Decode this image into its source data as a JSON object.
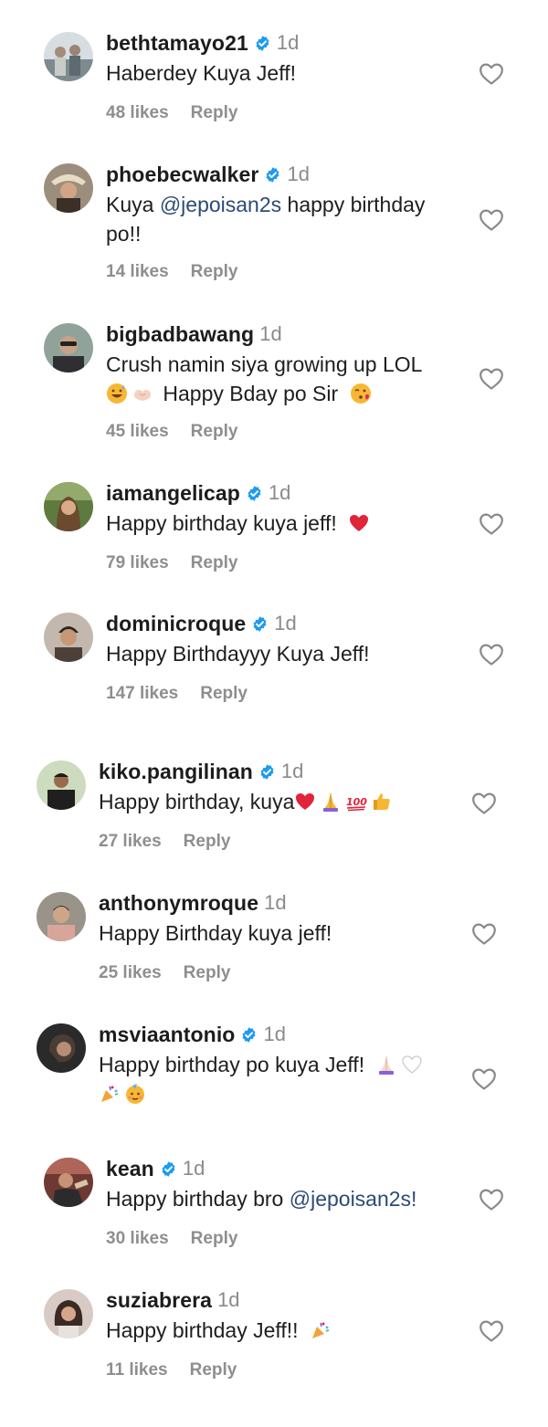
{
  "comments": [
    {
      "username": "bethtamayo21",
      "verified": true,
      "time": "1d",
      "text": "Haberdey Kuya Jeff!",
      "likes": "48 likes",
      "reply": "Reply",
      "avatar_color": "#7d8a8f"
    },
    {
      "username": "phoebecwalker",
      "verified": true,
      "time": "1d",
      "text_before": "Kuya ",
      "mention": "@jepoisan2s",
      "text_after": " happy birthday",
      "text_line2": "po!!",
      "likes": "14 likes",
      "reply": "Reply",
      "avatar_color": "#4a4038"
    },
    {
      "username": "bigbadbawang",
      "verified": false,
      "time": "1d",
      "text_line1": "Crush namin siya growing up LOL",
      "text_line2": "Happy Bday po Sir",
      "emojis_line2_before": [
        "grinning-sweat-emoji",
        "heart-hands-emoji"
      ],
      "emojis_line2_after": [
        "kissing-heart-emoji"
      ],
      "likes": "45 likes",
      "reply": "Reply",
      "avatar_color": "#6e7d74"
    },
    {
      "username": "iamangelicap",
      "verified": true,
      "time": "1d",
      "text": "Happy birthday kuya jeff!",
      "emojis_after": [
        "red-heart-emoji"
      ],
      "likes": "79 likes",
      "reply": "Reply",
      "avatar_color": "#8a7656"
    },
    {
      "username": "dominicroque",
      "verified": true,
      "time": "1d",
      "text": "Happy Birthdayyy Kuya Jeff!",
      "likes": "147 likes",
      "reply": "Reply",
      "avatar_color": "#5a4c44"
    },
    {
      "username": "kiko.pangilinan",
      "verified": true,
      "time": "1d",
      "text": "Happy birthday, kuya",
      "emojis_after": [
        "red-heart-emoji",
        "folded-hands-emoji",
        "hundred-points-emoji",
        "thumbs-up-emoji"
      ],
      "likes": "27 likes",
      "reply": "Reply",
      "avatar_color": "#b7c7a4"
    },
    {
      "username": "anthonymroque",
      "verified": false,
      "time": "1d",
      "text": "Happy Birthday kuya jeff!",
      "likes": "25 likes",
      "reply": "Reply",
      "avatar_color": "#7a7169"
    },
    {
      "username": "msviaantonio",
      "verified": true,
      "time": "1d",
      "text": "Happy birthday po kuya Jeff!",
      "emojis_after": [
        "folded-hands-emoji",
        "white-heart-emoji"
      ],
      "emojis_line2": [
        "party-popper-emoji",
        "partying-face-emoji"
      ],
      "avatar_color": "#3c3a3a"
    },
    {
      "username": "kean",
      "verified": true,
      "time": "1d",
      "text_before": "Happy birthday bro ",
      "mention": "@jepoisan2s!",
      "likes": "30 likes",
      "reply": "Reply",
      "avatar_color": "#8c4a3c"
    },
    {
      "username": "suziabrera",
      "verified": false,
      "time": "1d",
      "text": "Happy birthday Jeff!!",
      "emojis_after": [
        "party-popper-emoji"
      ],
      "likes": "11 likes",
      "reply": "Reply",
      "avatar_color": "#7e6a64"
    }
  ],
  "icons": {
    "like": "heart-outline-icon",
    "verified": "verified-badge-icon"
  },
  "colors": {
    "verified_blue": "#1d9bf0",
    "meta_gray": "#8e8e8e",
    "mention_blue": "#2c4a76"
  }
}
